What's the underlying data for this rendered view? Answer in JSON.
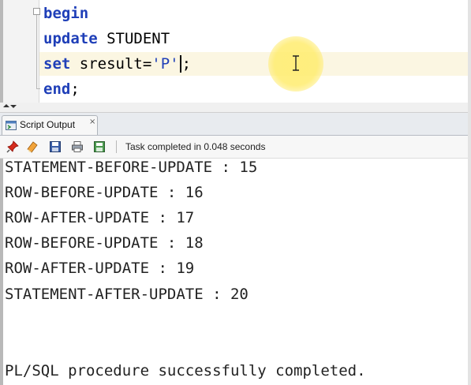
{
  "editor": {
    "lines": [
      {
        "kw": "begin",
        "rest": ""
      },
      {
        "kw": "update",
        "rest": " STUDENT"
      },
      {
        "kw": "set",
        "rest_pre": " sresult=",
        "str": "'P'",
        "rest_post": ";"
      },
      {
        "kw": "end",
        "rest": ";"
      }
    ],
    "fold_marker": "⊟"
  },
  "panel": {
    "tab_label": "Script Output",
    "tab_close": "×"
  },
  "toolbar": {
    "status": "Task completed in 0.048 seconds",
    "icons": [
      "pin-icon",
      "eraser-icon",
      "save-icon",
      "print-icon",
      "save-output-icon"
    ]
  },
  "output": {
    "lines": [
      "STATEMENT-BEFORE-UPDATE : 15",
      "ROW-BEFORE-UPDATE : 16",
      "ROW-AFTER-UPDATE : 17",
      "ROW-BEFORE-UPDATE : 18",
      "ROW-AFTER-UPDATE : 19",
      "STATEMENT-AFTER-UPDATE : 20",
      "",
      "",
      "PL/SQL procedure successfully completed."
    ]
  },
  "colors": {
    "keyword": "#1f3fb8",
    "current_line": "#fbf6e2",
    "cursor_highlight": "#ffee78"
  }
}
